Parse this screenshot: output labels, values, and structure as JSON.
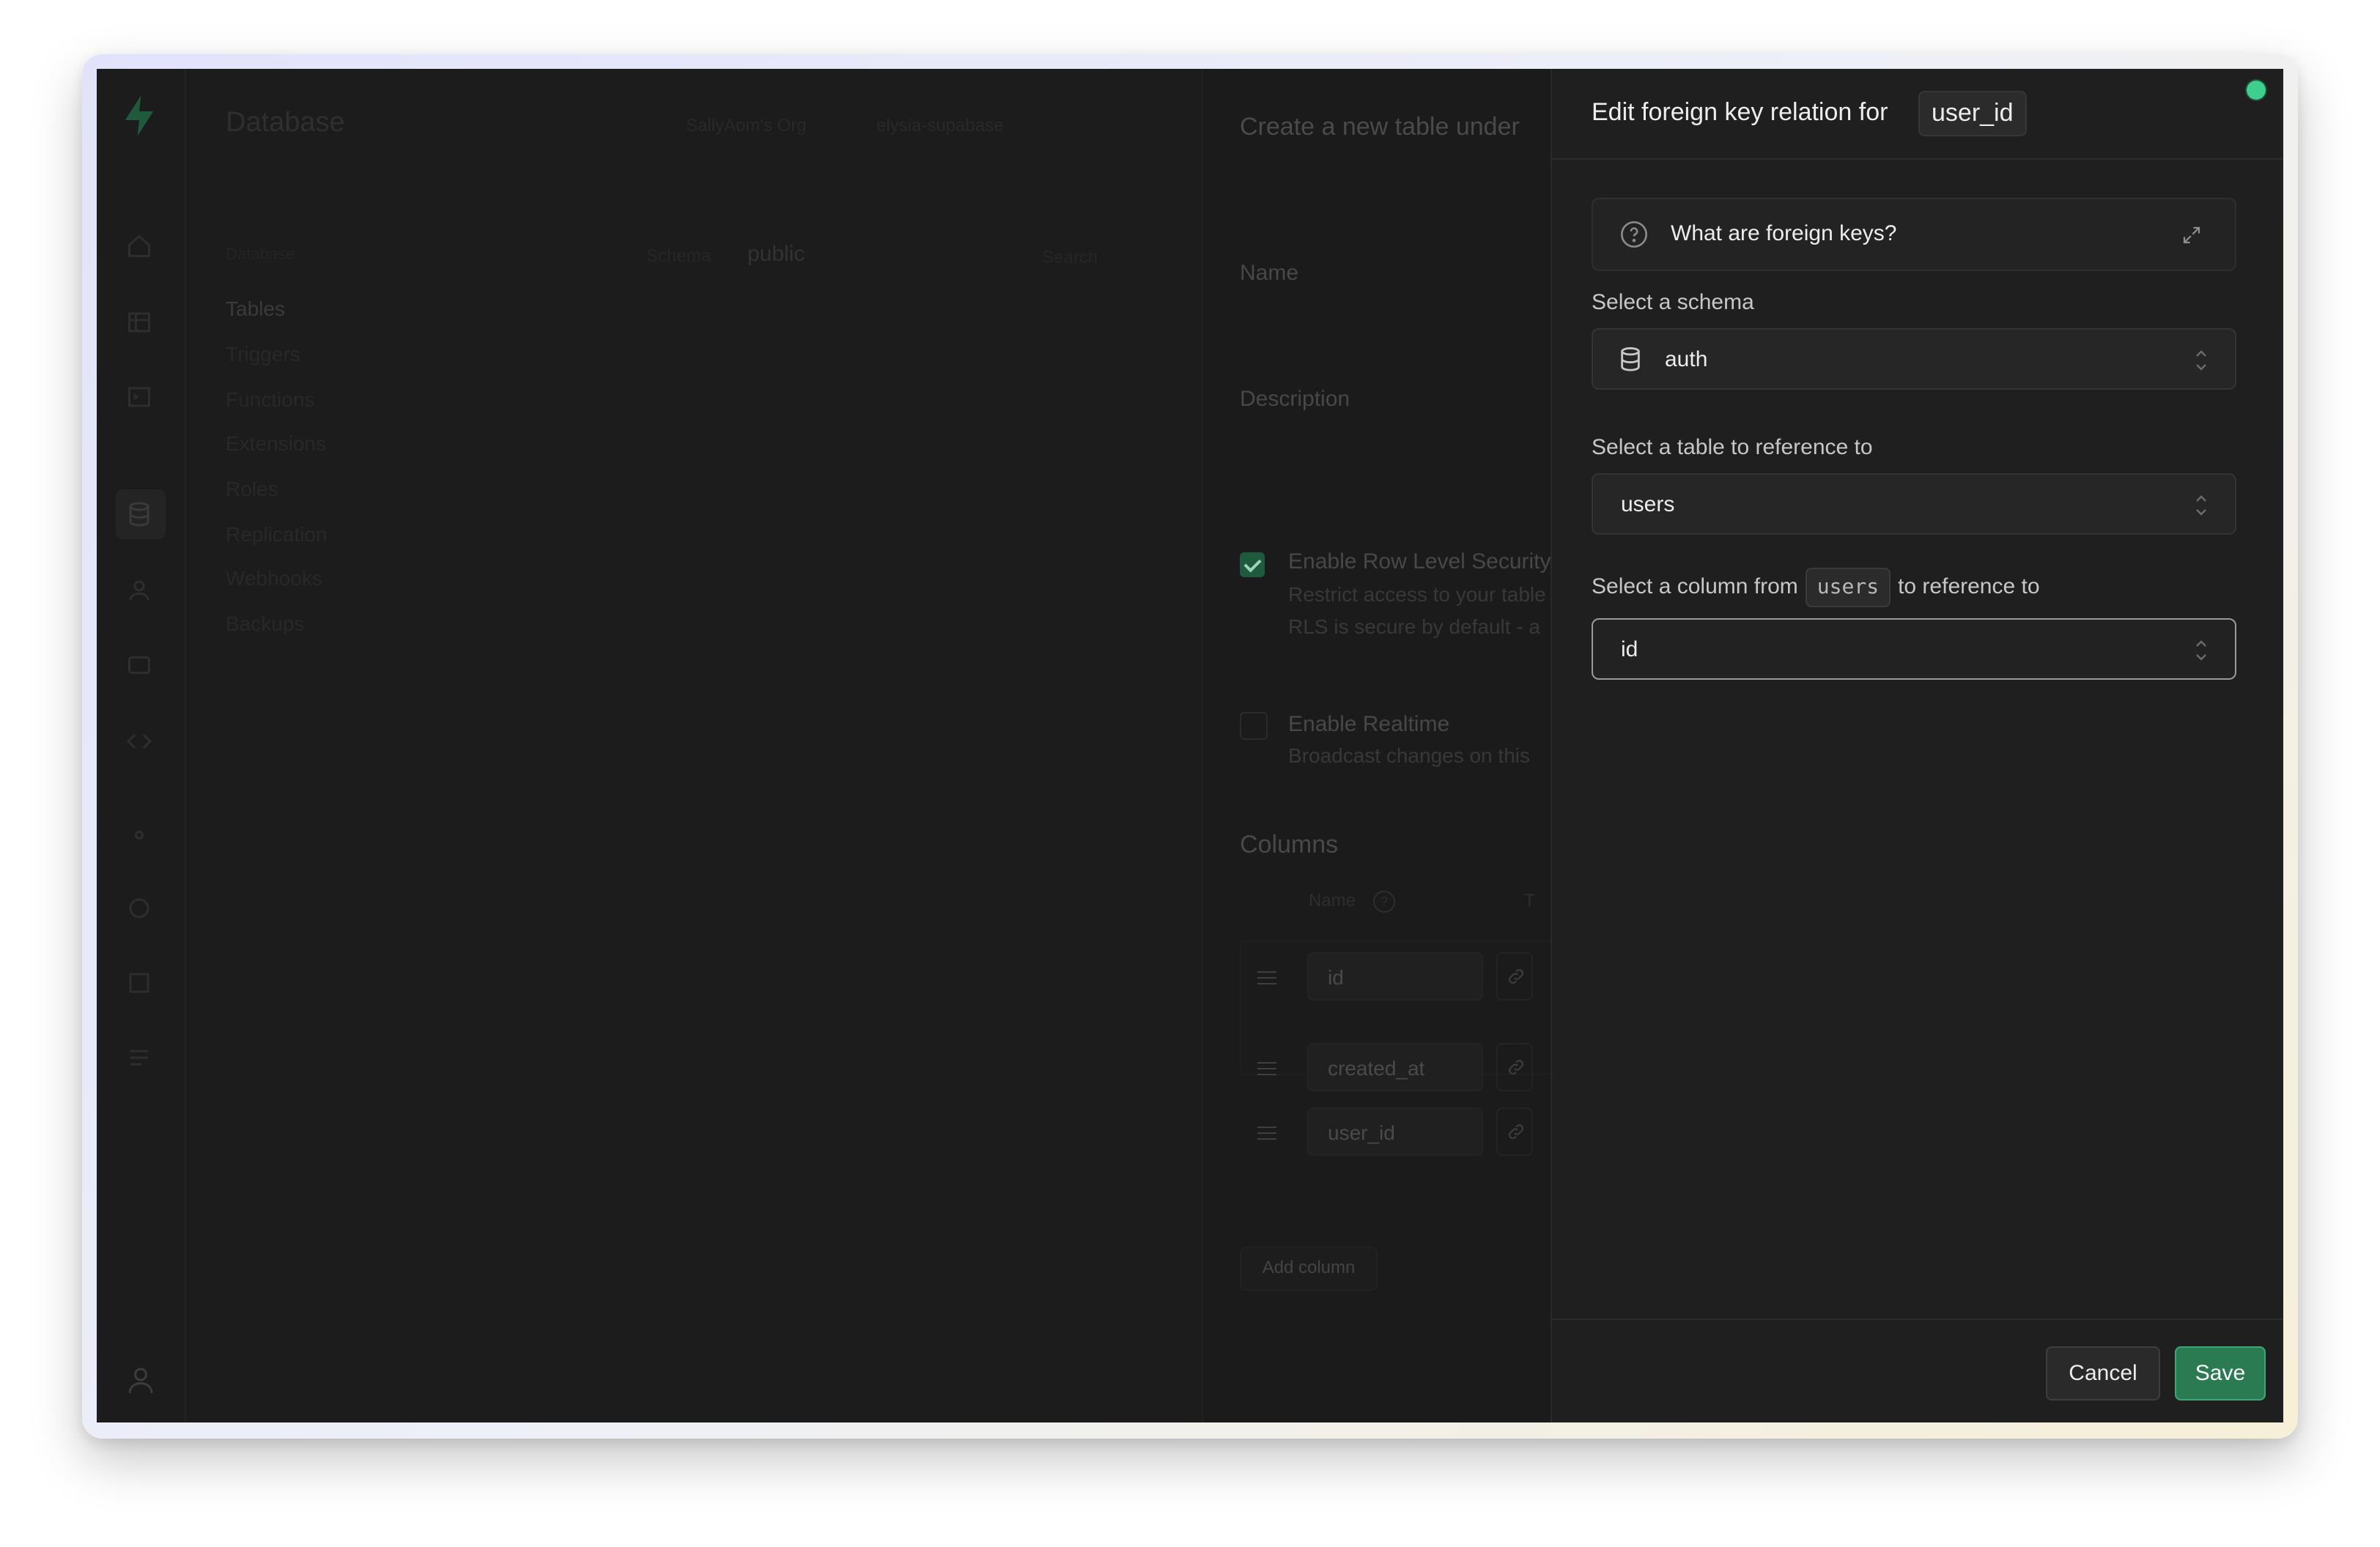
{
  "app": {
    "title": "Database",
    "breadcrumb": [
      "SallyAom's Org",
      "elysia-supabase"
    ]
  },
  "sidebar": {
    "section_header": "Database",
    "items": [
      "Tables",
      "Triggers",
      "Functions",
      "Extensions",
      "Roles",
      "Replication",
      "Webhooks",
      "Backups"
    ],
    "active": "Tables"
  },
  "table_list": {
    "schema_label": "Schema",
    "schema_value": "public",
    "search_placeholder": "Search"
  },
  "create_table": {
    "title": "Create a new table under",
    "name_label": "Name",
    "description_label": "Description",
    "rls": {
      "title": "Enable Row Level Security",
      "desc1": "Restrict access to your table",
      "desc2": "RLS is secure by default - a"
    },
    "realtime": {
      "title": "Enable Realtime",
      "desc": "Broadcast changes on this"
    },
    "columns_title": "Columns",
    "columns_header_name": "Name",
    "columns_header_type": "T",
    "columns": [
      {
        "name": "id"
      },
      {
        "name": "created_at"
      },
      {
        "name": "user_id"
      }
    ],
    "add_column_label": "Add column"
  },
  "panel": {
    "title": "Edit foreign key relation for",
    "column_code": "user_id",
    "accordion_label": "What are foreign keys?",
    "schema_label": "Select a schema",
    "schema_value": "auth",
    "table_label": "Select a table to reference to",
    "table_value": "users",
    "column_label_prefix": "Select a column from",
    "column_label_code": "users",
    "column_label_suffix": "to reference to",
    "column_value": "id",
    "cancel_label": "Cancel",
    "save_label": "Save"
  },
  "colors": {
    "brand_green": "#3ecf8e",
    "save_button": "#2a7a52",
    "panel_bg": "#1f1f1f",
    "app_bg": "#1c1c1c"
  },
  "icons": [
    "supabase-logo-icon",
    "database-icon",
    "question-circle-icon",
    "expand-icon",
    "chevrons-up-down-icon",
    "link-icon",
    "drag-handle-icon",
    "user-icon"
  ]
}
